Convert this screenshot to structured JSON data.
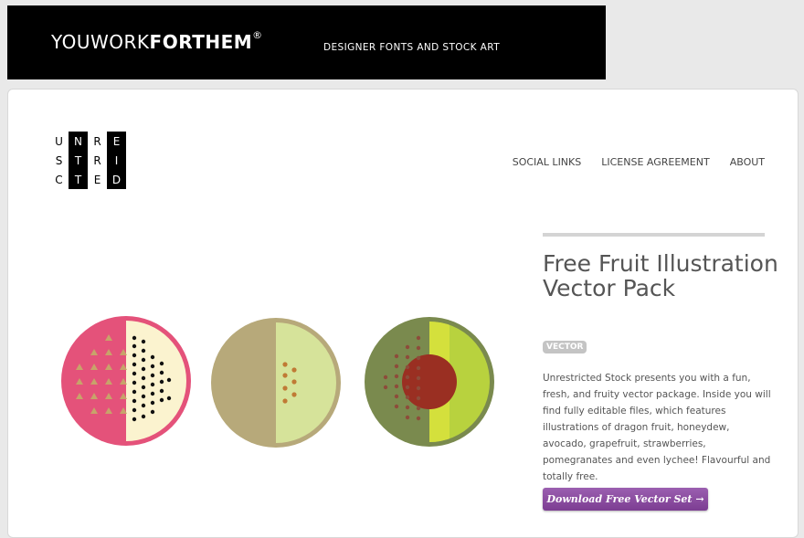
{
  "topbar": {
    "brand_light": "YOUWORK",
    "brand_bold": "FORTHEM",
    "brand_mark": "®",
    "tagline": "DESIGNER FONTS AND STOCK ART"
  },
  "logo": {
    "cells": [
      "U",
      "N",
      "R",
      "E",
      "S",
      "T",
      "R",
      "I",
      "C",
      "T",
      "E",
      "D"
    ]
  },
  "nav": {
    "items": [
      "SOCIAL LINKS",
      "LICENSE AGREEMENT",
      "ABOUT"
    ]
  },
  "article": {
    "title": "Free Fruit Illustration Vector Pack",
    "badge": "VECTOR",
    "description": "Unrestricted Stock presents you with a fun, fresh, and fruity vector package. Inside you will find fully editable files, which features illustrations of dragon fruit, honeydew, avocado, grapefruit, strawberries, pomegranates and even lychee! Flavourful and totally free.",
    "download_label": "Download Free Vector Set →"
  },
  "colors": {
    "dragonfruit": "#e4527a",
    "honeydew": "#b7a97a",
    "avocado": "#7a8a4e",
    "button": "#8a4aa0"
  }
}
